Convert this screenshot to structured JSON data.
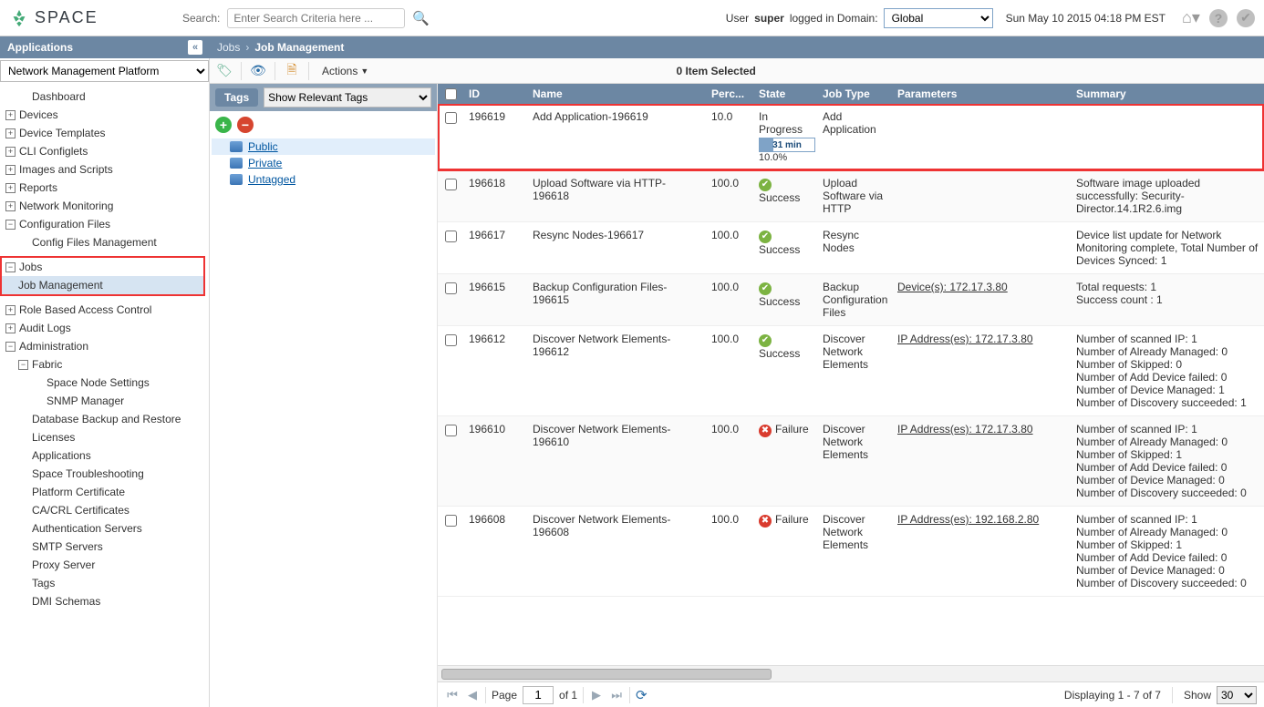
{
  "header": {
    "brand": "SPACE",
    "search_label": "Search:",
    "search_placeholder": "Enter Search Criteria here ...",
    "user_prefix": "User ",
    "user_name": "super",
    "user_mid": " logged in Domain:",
    "domain": "Global",
    "timestamp": "Sun May 10 2015 04:18 PM EST"
  },
  "apps_panel": {
    "title": "Applications",
    "module": "Network Management Platform"
  },
  "breadcrumb": {
    "level1": "Jobs",
    "current": "Job Management"
  },
  "sidebar": {
    "items": [
      {
        "label": "Dashboard",
        "toggle": "",
        "indent": 1
      },
      {
        "label": "Devices",
        "toggle": "+",
        "indent": 0
      },
      {
        "label": "Device Templates",
        "toggle": "+",
        "indent": 0
      },
      {
        "label": "CLI Configlets",
        "toggle": "+",
        "indent": 0
      },
      {
        "label": "Images and Scripts",
        "toggle": "+",
        "indent": 0
      },
      {
        "label": "Reports",
        "toggle": "+",
        "indent": 0
      },
      {
        "label": "Network Monitoring",
        "toggle": "+",
        "indent": 0
      },
      {
        "label": "Configuration Files",
        "toggle": "−",
        "indent": 0
      },
      {
        "label": "Config Files Management",
        "toggle": "",
        "indent": 1
      }
    ],
    "jobs_group": {
      "header": "Jobs",
      "header_toggle": "−",
      "child": "Job Management"
    },
    "after": [
      {
        "label": "Role Based Access Control",
        "toggle": "+",
        "indent": 0
      },
      {
        "label": "Audit Logs",
        "toggle": "+",
        "indent": 0
      },
      {
        "label": "Administration",
        "toggle": "−",
        "indent": 0
      },
      {
        "label": "Fabric",
        "toggle": "−",
        "indent": 1
      },
      {
        "label": "Space Node Settings",
        "toggle": "",
        "indent": 2
      },
      {
        "label": "SNMP Manager",
        "toggle": "",
        "indent": 2
      },
      {
        "label": "Database Backup and Restore",
        "toggle": "",
        "indent": 1
      },
      {
        "label": "Licenses",
        "toggle": "",
        "indent": 1
      },
      {
        "label": "Applications",
        "toggle": "",
        "indent": 1
      },
      {
        "label": "Space Troubleshooting",
        "toggle": "",
        "indent": 1
      },
      {
        "label": "Platform Certificate",
        "toggle": "",
        "indent": 1
      },
      {
        "label": "CA/CRL Certificates",
        "toggle": "",
        "indent": 1
      },
      {
        "label": "Authentication Servers",
        "toggle": "",
        "indent": 1
      },
      {
        "label": "SMTP Servers",
        "toggle": "",
        "indent": 1
      },
      {
        "label": "Proxy Server",
        "toggle": "",
        "indent": 1
      },
      {
        "label": "Tags",
        "toggle": "",
        "indent": 1
      },
      {
        "label": "DMI Schemas",
        "toggle": "",
        "indent": 1
      }
    ]
  },
  "toolbar": {
    "actions": "Actions",
    "selected": "0 Item Selected"
  },
  "tags": {
    "title": "Tags",
    "mode": "Show Relevant Tags",
    "items": [
      {
        "label": "Public",
        "sel": true
      },
      {
        "label": "Private",
        "sel": false
      },
      {
        "label": "Untagged",
        "sel": false
      }
    ]
  },
  "grid": {
    "headers": {
      "id": "ID",
      "name": "Name",
      "perc": "Perc...",
      "state": "State",
      "type": "Job Type",
      "params": "Parameters",
      "summary": "Summary"
    },
    "rows": [
      {
        "id": "196619",
        "name": "Add Application-196619",
        "perc": "10.0",
        "state": "In Progress",
        "state_kind": "progress",
        "progress_label": "31 min",
        "progress_sub": "10.0%",
        "type": "Add Application",
        "params": "",
        "summary": "",
        "highlight": true
      },
      {
        "id": "196618",
        "name": "Upload Software via HTTP-196618",
        "perc": "100.0",
        "state": "Success",
        "state_kind": "ok",
        "type": "Upload Software via HTTP",
        "params": "",
        "summary": "Software image uploaded successfully: Security-Director.14.1R2.6.img"
      },
      {
        "id": "196617",
        "name": "Resync Nodes-196617",
        "perc": "100.0",
        "state": "Success",
        "state_kind": "ok",
        "type": "Resync Nodes",
        "params": "",
        "summary": "Device list update for Network Monitoring complete, Total Number of Devices Synced: 1"
      },
      {
        "id": "196615",
        "name": "Backup Configuration Files-196615",
        "perc": "100.0",
        "state": "Success",
        "state_kind": "ok",
        "type": "Backup Configuration Files",
        "params": "Device(s): 172.17.3.80",
        "summary": "Total requests: 1\nSuccess count : 1"
      },
      {
        "id": "196612",
        "name": "Discover Network Elements-196612",
        "perc": "100.0",
        "state": "Success",
        "state_kind": "ok",
        "type": "Discover Network Elements",
        "params": "IP Address(es): 172.17.3.80",
        "summary": "Number of scanned IP: 1\nNumber of Already Managed: 0\nNumber of Skipped: 0\nNumber of Add Device failed: 0\nNumber of Device Managed: 1\nNumber of Discovery succeeded: 1"
      },
      {
        "id": "196610",
        "name": "Discover Network Elements-196610",
        "perc": "100.0",
        "state": "Failure",
        "state_kind": "fail",
        "type": "Discover Network Elements",
        "params": "IP Address(es): 172.17.3.80",
        "summary": "Number of scanned IP: 1\nNumber of Already Managed: 0\nNumber of Skipped: 1\nNumber of Add Device failed: 0\nNumber of Device Managed: 0\nNumber of Discovery succeeded: 0"
      },
      {
        "id": "196608",
        "name": "Discover Network Elements-196608",
        "perc": "100.0",
        "state": "Failure",
        "state_kind": "fail",
        "type": "Discover Network Elements",
        "params": "IP Address(es): 192.168.2.80",
        "summary": "Number of scanned IP: 1\nNumber of Already Managed: 0\nNumber of Skipped: 1\nNumber of Add Device failed: 0\nNumber of Device Managed: 0\nNumber of Discovery succeeded: 0"
      }
    ]
  },
  "footer": {
    "page_label": "Page",
    "page_value": "1",
    "of_label": "of 1",
    "display": "Displaying 1 - 7 of 7",
    "show_label": "Show",
    "show_value": "30"
  }
}
